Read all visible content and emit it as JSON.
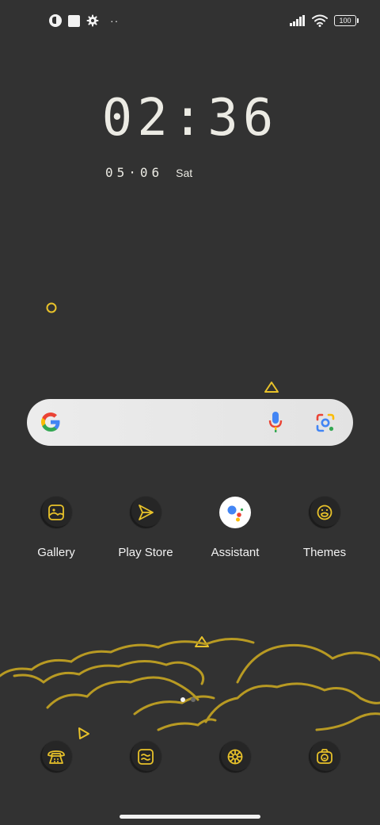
{
  "status_bar": {
    "battery": "100",
    "left_icons": [
      "app-notification-icon",
      "square-notification-icon",
      "settings-icon",
      "more-dots-icon"
    ],
    "right_icons": [
      "signal-icon",
      "wifi-icon",
      "battery-icon"
    ]
  },
  "clock": {
    "time": "02:36",
    "date": "05·06",
    "day": "Sat"
  },
  "search": {
    "icons": [
      "google-logo-icon",
      "microphone-icon",
      "google-lens-icon"
    ]
  },
  "apps": [
    {
      "label": "Gallery",
      "icon": "gallery-icon"
    },
    {
      "label": "Play Store",
      "icon": "play-store-icon"
    },
    {
      "label": "Assistant",
      "icon": "assistant-icon"
    },
    {
      "label": "Themes",
      "icon": "themes-icon"
    }
  ],
  "dock": [
    {
      "icon": "phone-icon"
    },
    {
      "icon": "messages-icon"
    },
    {
      "icon": "browser-icon"
    },
    {
      "icon": "camera-icon"
    }
  ],
  "pages": {
    "count": 2,
    "current": 1
  },
  "colors": {
    "background": "#323232",
    "accent": "#e8c22a",
    "text": "#ecebe4"
  }
}
